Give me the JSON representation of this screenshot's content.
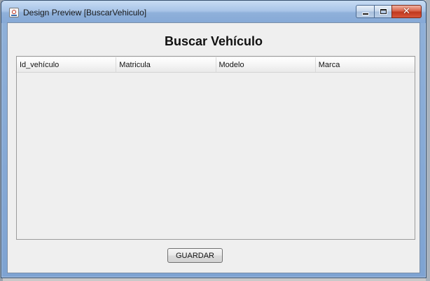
{
  "window": {
    "title": "Design Preview [BuscarVehiculo]",
    "icon": "java-icon",
    "controls": {
      "minimize": "minimize-icon",
      "maximize": "maximize-icon",
      "close": "close-icon",
      "close_glyph": "✕"
    }
  },
  "form": {
    "heading": "Buscar Vehículo",
    "table": {
      "columns": [
        "Id_vehículo",
        "Matricula",
        "Modelo",
        "Marca"
      ],
      "rows": []
    },
    "save_label": "GUARDAR"
  },
  "colors": {
    "close_button": "#c0391f",
    "titlebar": "#a9c5e8",
    "client_bg": "#efefef"
  }
}
